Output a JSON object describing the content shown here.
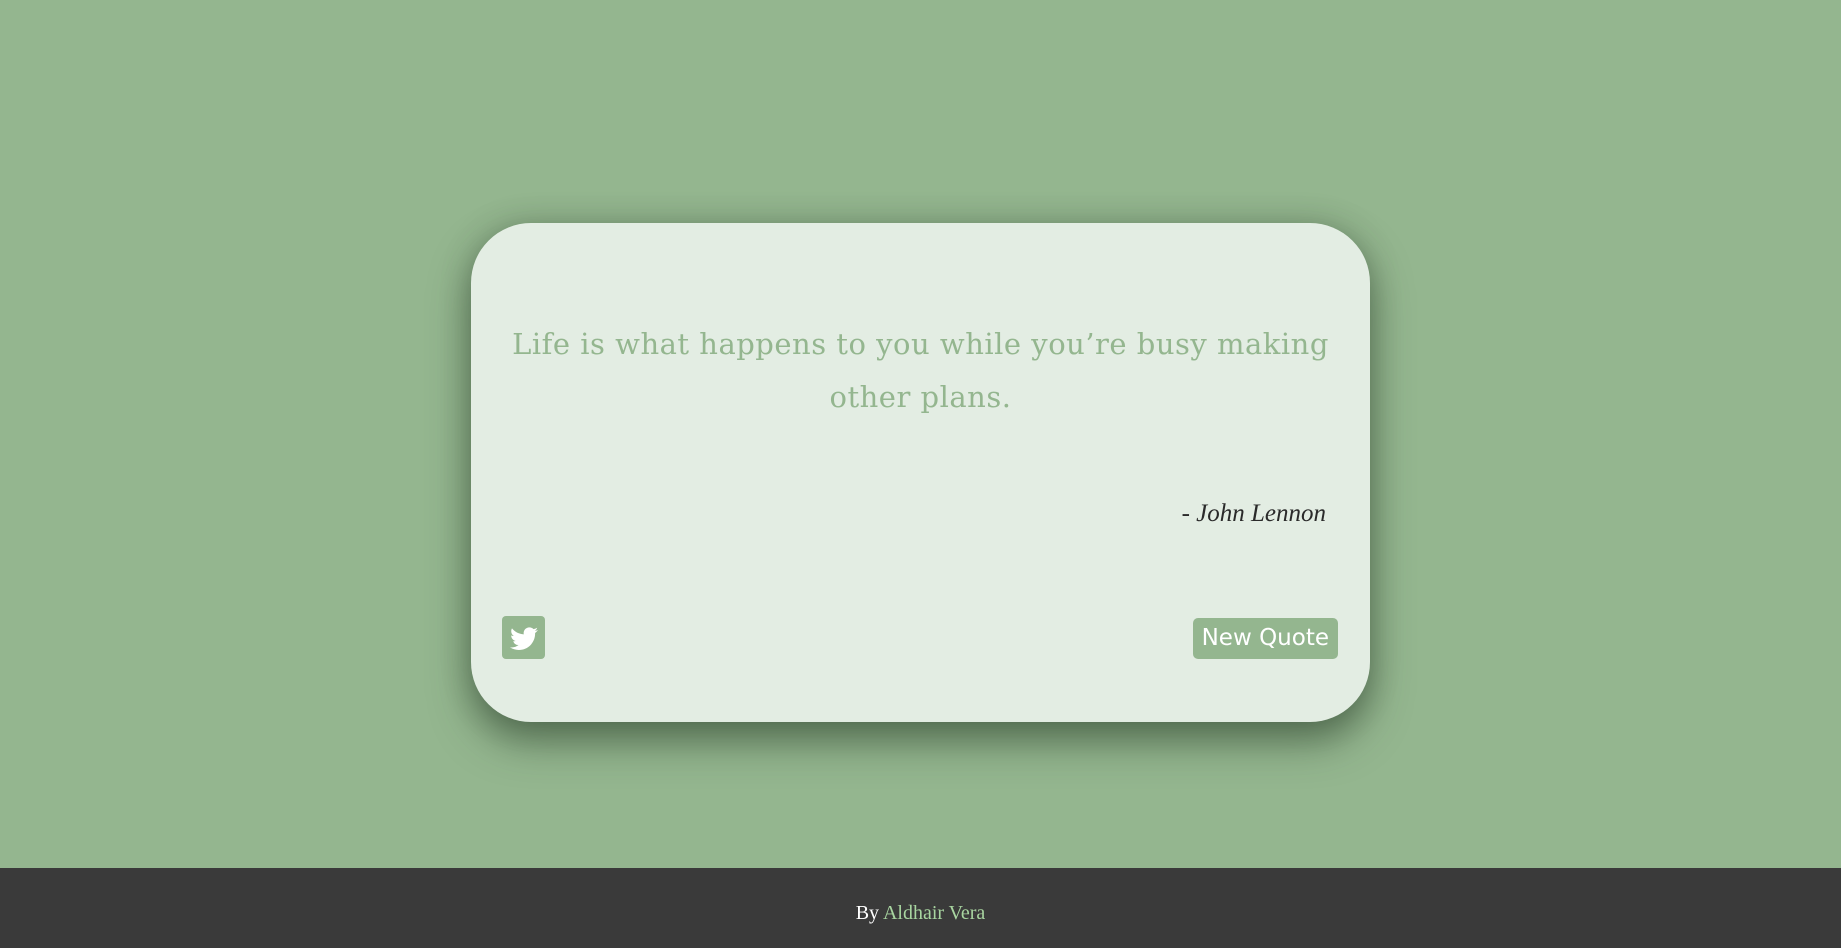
{
  "quote": {
    "text": "Life is what happens to you while you’re busy making other plans.",
    "author": "- John Lennon"
  },
  "actions": {
    "tweet_icon": "twitter-icon",
    "new_quote_label": "New Quote"
  },
  "footer": {
    "prefix": "By",
    "author_link": "Aldhair Vera"
  },
  "colors": {
    "background": "#94b68f",
    "card": "#e3ede3",
    "accent": "#94b68f",
    "footer": "#3a3a3a",
    "footer_link": "#a8d5a0"
  }
}
